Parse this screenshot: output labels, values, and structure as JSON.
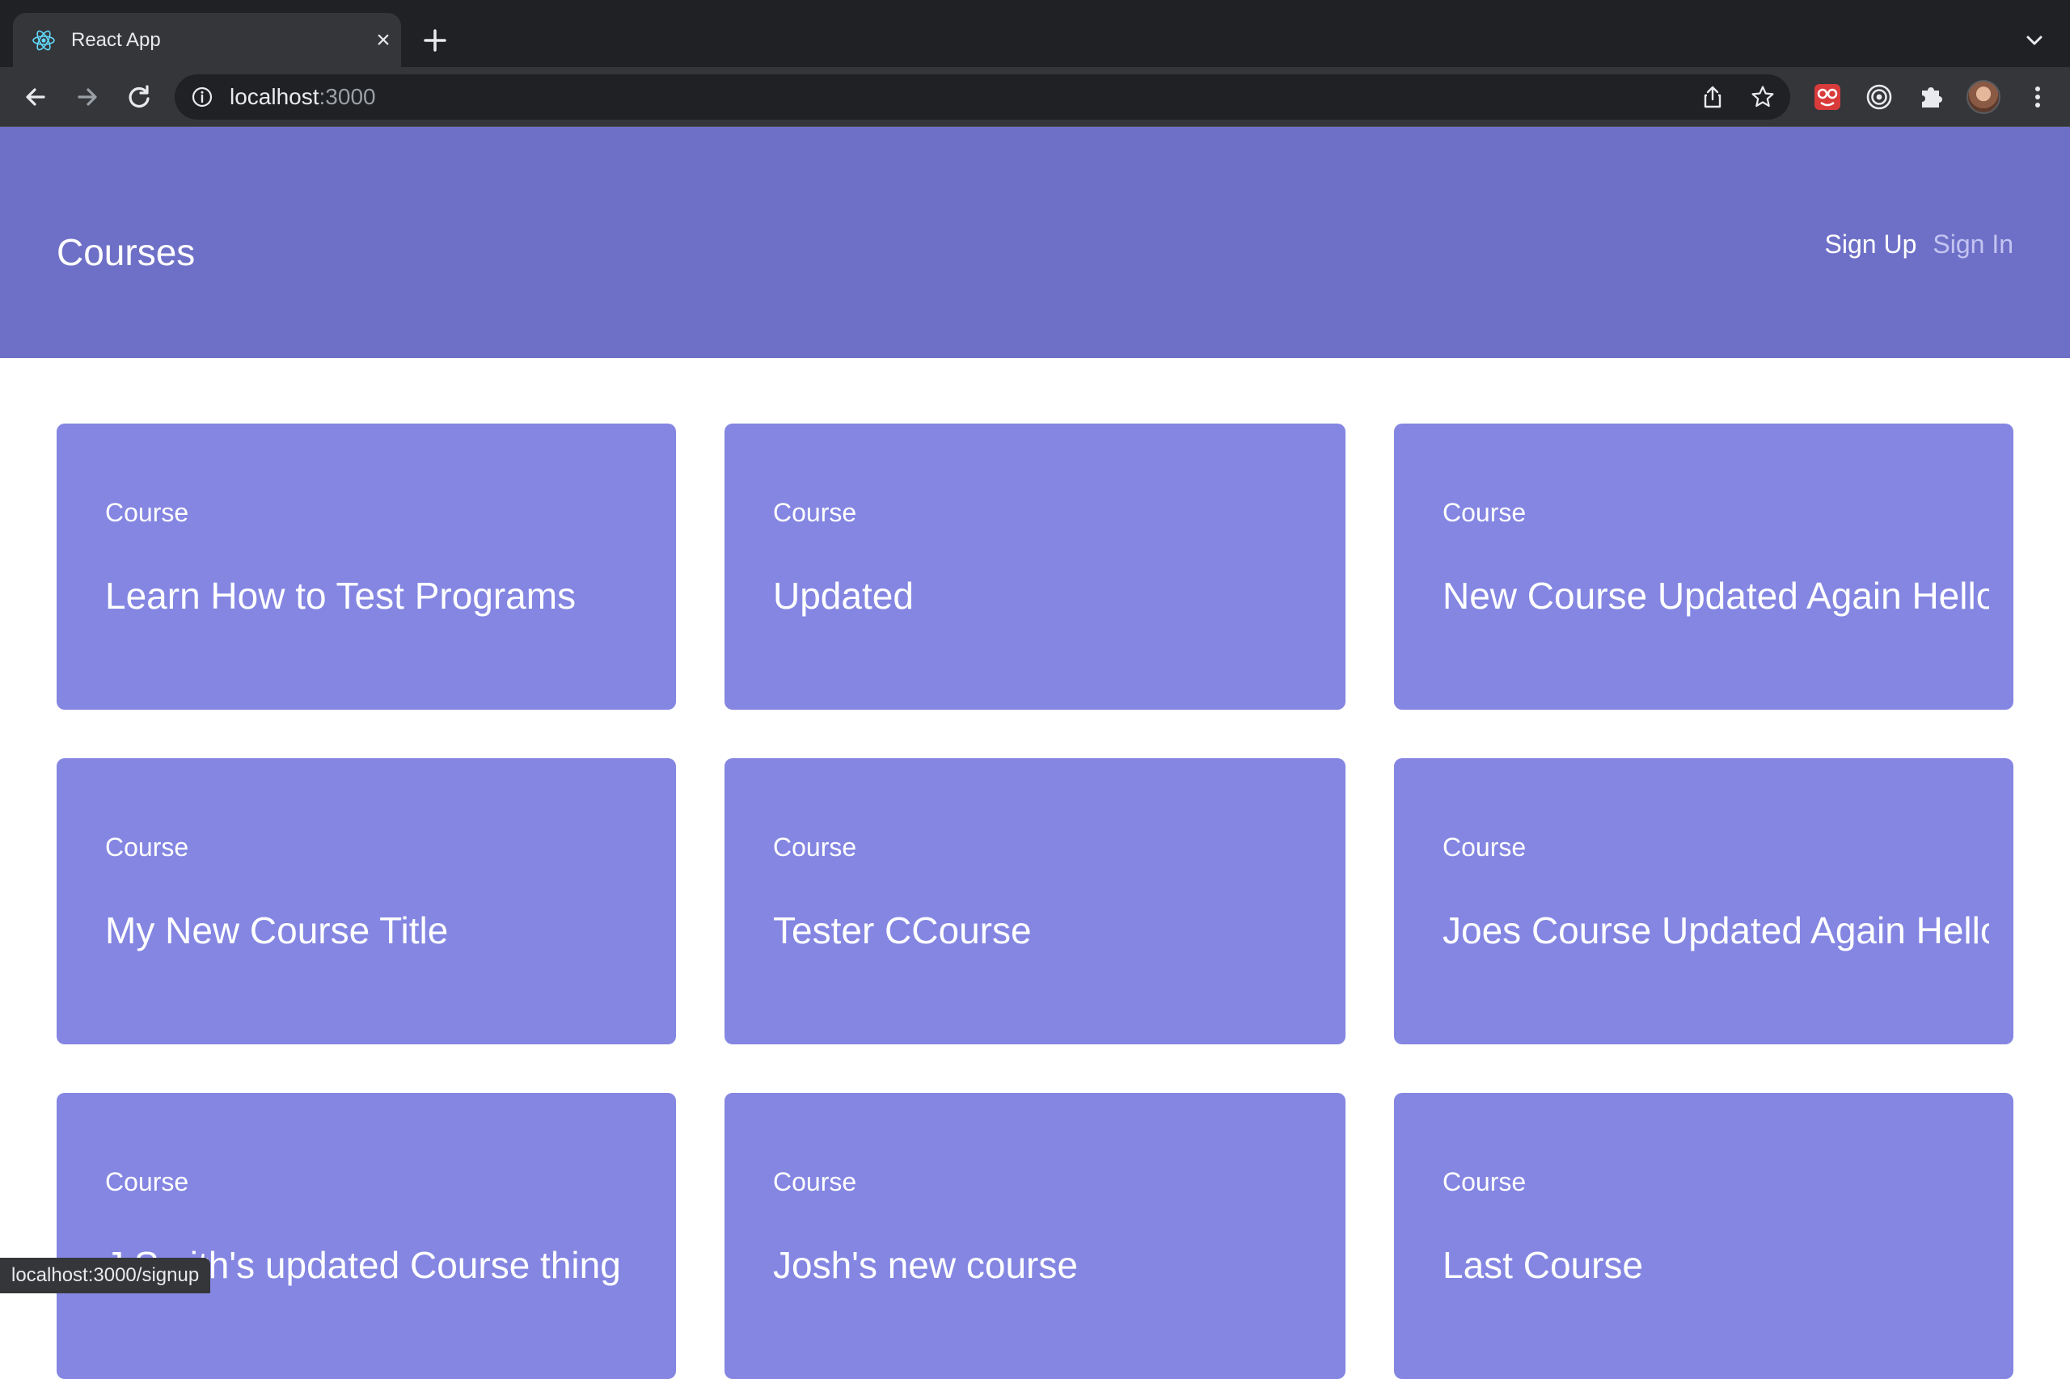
{
  "browser": {
    "tab_title": "React App",
    "url_host": "localhost",
    "url_port": ":3000",
    "status_url": "localhost:3000/signup"
  },
  "header": {
    "title": "Courses",
    "nav": {
      "signup": "Sign Up",
      "signin": "Sign In"
    }
  },
  "courses": [
    {
      "label": "Course",
      "title": "Learn How to Test Programs"
    },
    {
      "label": "Course",
      "title": "Updated"
    },
    {
      "label": "Course",
      "title": "New Course Updated Again Hello"
    },
    {
      "label": "Course",
      "title": "My New Course Title"
    },
    {
      "label": "Course",
      "title": "Tester CCourse"
    },
    {
      "label": "Course",
      "title": "Joes Course Updated Again Hello"
    },
    {
      "label": "Course",
      "title": "J Smith's updated Course thing"
    },
    {
      "label": "Course",
      "title": "Josh's new course"
    },
    {
      "label": "Course",
      "title": "Last Course"
    }
  ],
  "colors": {
    "header_bg": "#6e70c7",
    "card_bg": "#8486e2",
    "signin_link": "#c3c4f2"
  },
  "icons": {
    "favicon": "react-logo-icon",
    "close": "close-icon",
    "new_tab": "plus-icon",
    "back": "arrow-left-icon",
    "forward": "arrow-right-icon",
    "reload": "reload-icon",
    "site_info": "info-icon",
    "share": "share-icon",
    "bookmark": "star-icon",
    "extensions": "puzzle-icon",
    "menu": "kebab-menu-icon"
  }
}
